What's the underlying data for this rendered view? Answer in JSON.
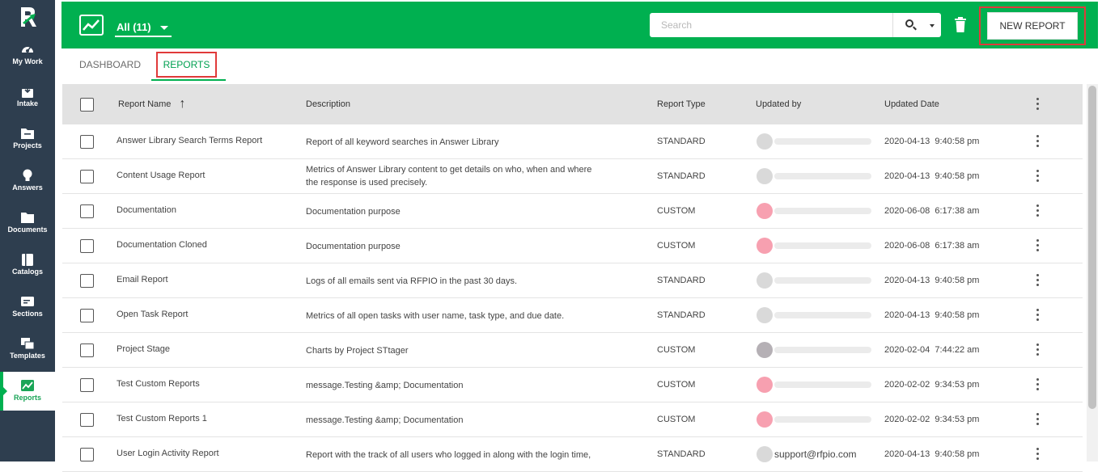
{
  "sidebar": {
    "items": [
      {
        "label": "My Work",
        "icon": "gauge-icon"
      },
      {
        "label": "Intake",
        "icon": "intake-icon"
      },
      {
        "label": "Projects",
        "icon": "folder-icon"
      },
      {
        "label": "Answers",
        "icon": "lightbulb-icon"
      },
      {
        "label": "Documents",
        "icon": "documents-icon"
      },
      {
        "label": "Catalogs",
        "icon": "catalog-icon"
      },
      {
        "label": "Sections",
        "icon": "sections-icon"
      },
      {
        "label": "Templates",
        "icon": "templates-icon"
      },
      {
        "label": "Reports",
        "icon": "reports-icon",
        "active": true
      }
    ]
  },
  "toolbar": {
    "filter_label": "All (11)",
    "search_placeholder": "Search",
    "new_report_label": "NEW REPORT"
  },
  "tabs": {
    "dashboard": "DASHBOARD",
    "reports": "REPORTS"
  },
  "table": {
    "headers": {
      "name": "Report Name",
      "description": "Description",
      "type": "Report Type",
      "updated_by": "Updated by",
      "updated_date": "Updated Date"
    },
    "rows": [
      {
        "name": "Answer Library Search Terms Report",
        "desc1": "Report of all keyword searches in Answer Library",
        "desc2": "",
        "type": "STANDARD",
        "updated_by": "",
        "date": "2020-04-13  9:40:58 pm",
        "avatar": "#d9d9d9"
      },
      {
        "name": "Content Usage Report",
        "desc1": "Metrics of Answer Library content to get details on who, when and where",
        "desc2": "the response is used precisely.",
        "type": "STANDARD",
        "updated_by": "",
        "date": "2020-04-13  9:40:58 pm",
        "avatar": "#d9d9d9"
      },
      {
        "name": "Documentation",
        "desc1": "Documentation purpose",
        "desc2": "",
        "type": "CUSTOM",
        "updated_by": "",
        "date": "2020-06-08  6:17:38 am",
        "avatar": "#f7a0b0"
      },
      {
        "name": "Documentation Cloned",
        "desc1": "Documentation purpose",
        "desc2": "",
        "type": "CUSTOM",
        "updated_by": "",
        "date": "2020-06-08  6:17:38 am",
        "avatar": "#f7a0b0"
      },
      {
        "name": "Email Report",
        "desc1": "Logs of all emails sent via RFPIO in the past 30 days.",
        "desc2": "",
        "type": "STANDARD",
        "updated_by": "",
        "date": "2020-04-13  9:40:58 pm",
        "avatar": "#d9d9d9"
      },
      {
        "name": "Open Task Report",
        "desc1": "Metrics of all open tasks with user name, task type, and due date.",
        "desc2": "",
        "type": "STANDARD",
        "updated_by": "",
        "date": "2020-04-13  9:40:58 pm",
        "avatar": "#d9d9d9"
      },
      {
        "name": "Project Stage",
        "desc1": "Charts by Project STtager",
        "desc2": "",
        "type": "CUSTOM",
        "updated_by": "",
        "date": "2020-02-04  7:44:22 am",
        "avatar": "#b5b0b5"
      },
      {
        "name": "Test Custom Reports",
        "desc1": "message.Testing &amp; Documentation",
        "desc2": "",
        "type": "CUSTOM",
        "updated_by": "",
        "date": "2020-02-02  9:34:53 pm",
        "avatar": "#f7a0b0"
      },
      {
        "name": "Test Custom Reports 1",
        "desc1": "message.Testing &amp; Documentation",
        "desc2": "",
        "type": "CUSTOM",
        "updated_by": "",
        "date": "2020-02-02  9:34:53 pm",
        "avatar": "#f7a0b0"
      },
      {
        "name": "User Login Activity Report",
        "desc1": "Report with the track of all users who logged in along with the login time,",
        "desc2": "",
        "type": "STANDARD",
        "updated_by": "support@rfpio.com",
        "date": "2020-04-13  9:40:58 pm",
        "avatar": "#d9d9d9"
      }
    ]
  },
  "colors": {
    "brand_green": "#00b050",
    "sidebar_bg": "#2e3e4f",
    "highlight_red": "#e03a3a"
  }
}
